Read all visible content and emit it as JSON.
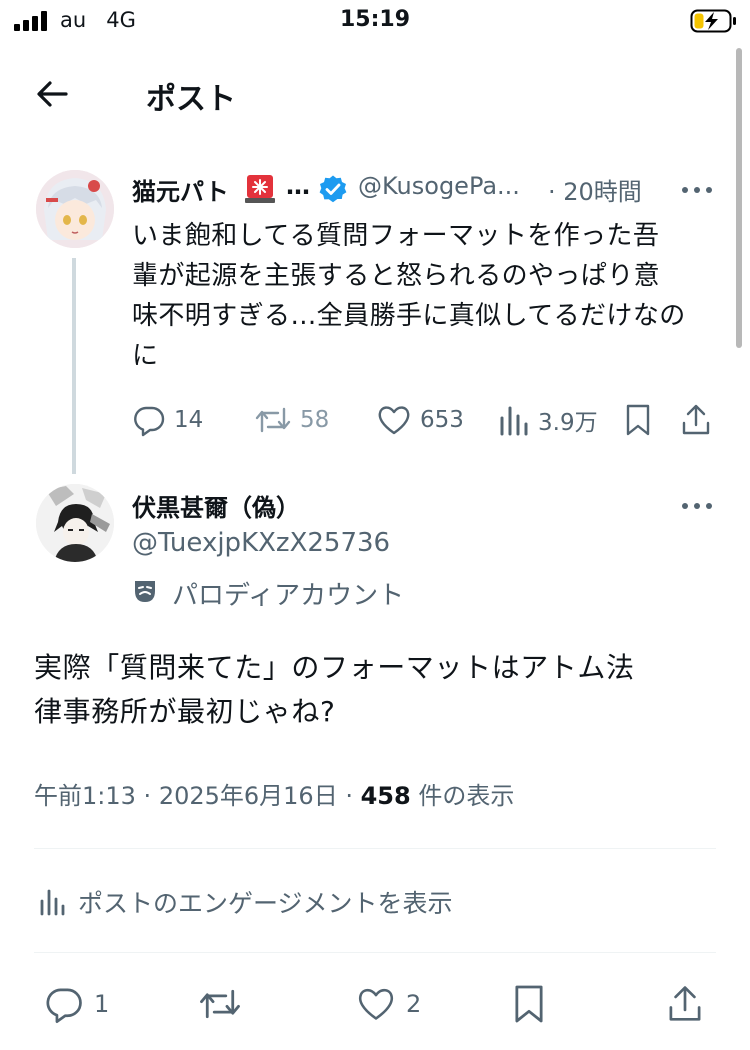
{
  "status_bar": {
    "carrier": "au",
    "network": "4G",
    "time": "15:19"
  },
  "header": {
    "title": "ポスト",
    "back_icon": "arrow-left-icon"
  },
  "parent_post": {
    "display_name": "猫元パト",
    "name_emoji": "police-siren-icon",
    "name_truncation": "…",
    "verified_color": "#1d9bf0",
    "handle": "@KusogePa...",
    "time": "· 20時間",
    "text": "いま飽和してる質問フォーマットを作った吾\n輩が起源を主張すると怒られるのやっぱり意\n味不明すぎる…全員勝手に真似してるだけなの\nに",
    "replies": "14",
    "reposts": "58",
    "likes": "653",
    "views": "3.9万"
  },
  "post": {
    "display_name": "伏黒甚爾（偽）",
    "handle": "@TuexjpKXzX25736",
    "parody_label": "パロディアカウント",
    "text": "実際「質問来てた」のフォーマットはアトム法\n律事務所が最初じゃね?",
    "time": "午前1:13",
    "date": "2025年6月16日",
    "view_count": "458",
    "view_suffix": "件の表示",
    "engagement_label": "ポストのエンゲージメントを表示",
    "replies": "1",
    "likes": "2"
  },
  "colors": {
    "text": "#0f1419",
    "secondary": "#536471",
    "accent": "#1d9bf0",
    "divider": "#eff3f4"
  }
}
